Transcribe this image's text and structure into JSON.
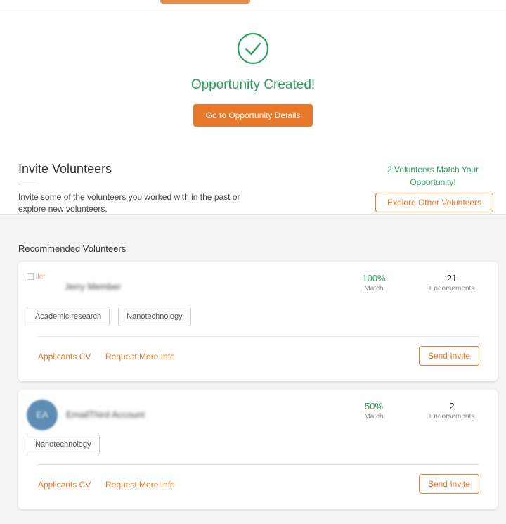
{
  "success": {
    "title": "Opportunity Created!",
    "details_button": "Go to Opportunity Details"
  },
  "invite": {
    "title": "Invite Volunteers",
    "description": "Invite some of the volunteers you worked with in the past or explore new volunteers.",
    "match_text": "2 Volunteers Match Your Opportunity!",
    "explore_button": "Explore Other Volunteers"
  },
  "recommended": {
    "title": "Recommended Volunteers",
    "volunteers": [
      {
        "avatar_alt": "Jer",
        "name": "Jerry Member",
        "match_value": "100%",
        "match_label": "Match",
        "endorsements_value": "21",
        "endorsements_label": "Endorsements",
        "tags": [
          "Academic research",
          "Nanotechnology"
        ],
        "cv_link": "Applicants CV",
        "info_link": "Request More Info",
        "invite_button": "Send Invite"
      },
      {
        "avatar_initials": "EA",
        "name": "EmailThird Account",
        "match_value": "50%",
        "match_label": "Match",
        "endorsements_value": "2",
        "endorsements_label": "Endorsements",
        "tags": [
          "Nanotechnology"
        ],
        "cv_link": "Applicants CV",
        "info_link": "Request More Info",
        "invite_button": "Send Invite"
      }
    ]
  },
  "colors": {
    "accent": "#e8782a",
    "success": "#2e9e5b",
    "avatar": "#5e8cb2"
  },
  "icons": {
    "success": "check-circle-icon"
  }
}
